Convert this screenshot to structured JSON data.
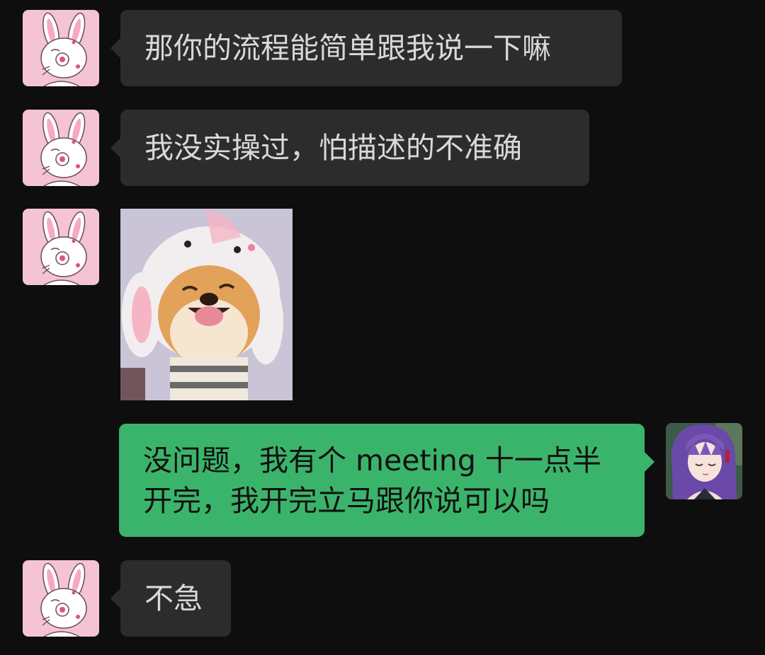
{
  "messages": [
    {
      "side": "incoming",
      "avatar": "pink-rabbit-avatar",
      "text": "那你的流程能简单跟我说一下嘛"
    },
    {
      "side": "incoming",
      "avatar": "pink-rabbit-avatar",
      "text": "我没实操过，怕描述的不准确"
    },
    {
      "side": "incoming",
      "avatar": "pink-rabbit-avatar",
      "sticker": "shiba-dog-in-bunny-hood-sticker"
    },
    {
      "side": "outgoing",
      "avatar": "purple-haired-anime-girl-avatar",
      "lines": [
        "没问题，我有个 meeting 十一点半",
        "开完，我开完立马跟你说可以吗"
      ]
    },
    {
      "side": "incoming",
      "avatar": "pink-rabbit-avatar",
      "text": "不急"
    }
  ],
  "colors": {
    "background": "#0e0e0f",
    "incoming_bubble": "#2c2c2c",
    "incoming_text": "#d9d9d9",
    "outgoing_bubble": "#3bb46b",
    "outgoing_text": "#111111",
    "rabbit_avatar_bg": "#f4c3d6"
  }
}
